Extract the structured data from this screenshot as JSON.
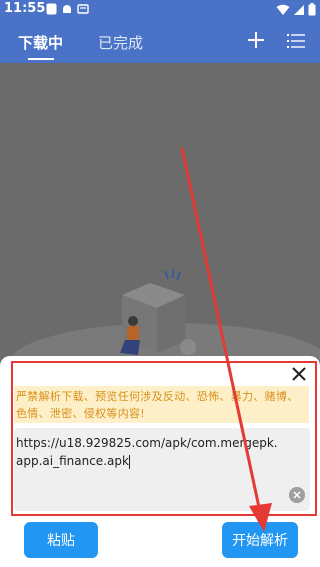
{
  "status_bar": {
    "time": "11:55"
  },
  "tabs": [
    {
      "label": "下载中",
      "active": true
    },
    {
      "label": "已完成",
      "active": false
    }
  ],
  "toolbar": {
    "add_icon": "plus-icon",
    "menu_icon": "list-menu-icon"
  },
  "dialog": {
    "warning": "严禁解析下载、预览任何涉及反动、恐怖、暴力、赌博、色情、泄密、侵权等内容!",
    "url_value": "https://u18.929825.com/apk/com.mergepk.app.ai_finance.apk",
    "paste_label": "粘贴",
    "parse_label": "开始解析"
  },
  "colors": {
    "primary": "#4a73c8",
    "button": "#2196f3",
    "annotation": "#e53935",
    "warning_bg": "#fdf0c8",
    "warning_text": "#d98f1a"
  }
}
